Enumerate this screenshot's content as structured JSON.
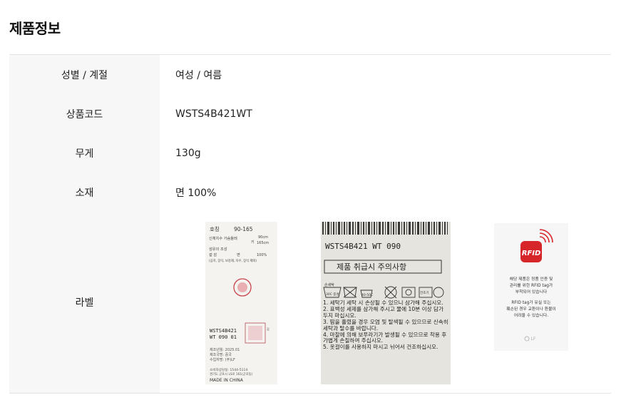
{
  "section": {
    "title": "제품정보"
  },
  "rows": [
    {
      "label": "성별 / 계절",
      "value": "여성 / 여름"
    },
    {
      "label": "상품코드",
      "value": "WSTS4B421WT"
    },
    {
      "label": "무게",
      "value": "130g"
    },
    {
      "label": "소재",
      "value": "면 100%"
    },
    {
      "label": "라벨"
    }
  ],
  "label_images": {
    "size_tag": {
      "lines": [
        "호칭",
        "90-165",
        "신체치수 가슴둘레",
        "90cm",
        "키",
        "165cm",
        "섬유의 조성",
        "겉 감",
        "면",
        "100%",
        "(심지, 장식, 보강재, 자수, 장식 제외)"
      ],
      "code": "WSTS4B421",
      "code2": "WT 090 01",
      "info": [
        "제조년월: 2025.01",
        "제조국명: 중국",
        "수입자명: (주)LF",
        "소비자상담실: 1544-5114",
        "경기도 군포시 LS로 161(군포동)",
        "MADE IN CHINA"
      ]
    },
    "care_tag": {
      "code": "WSTS4B421 WT 090",
      "heading": "제품 취급시 주의사항",
      "icons": [
        "손세탁",
        "30C 중성",
        "40-50C",
        "건조기"
      ],
      "steps": [
        "1. 세탁기 세탁 시 손상될 수 있으니 삼가해 주십시오.",
        "2. 표백성 세제를 삼가해 주시고 물에 10분 이상 담가 두지 마십시오.",
        "3. 땀을 흘렸을 경우 오염 및 탈색될 수 있으므로 신속히 세탁과 탈수를 바랍니다.",
        "4. 마찰에 의해 보푸라기가 발생될 수 있으므로 착용 후 가볍게 손질하여 주십시오.",
        "5. 옷걸이를 사용하지 마시고 뉘어서 건조하십시오."
      ]
    },
    "rfid_tag": {
      "logo": "RFID",
      "text1": [
        "해당 제품은 정품 인증 및",
        "관리를 위한 RFID tag가",
        "부착되어 있습니다"
      ],
      "text2": [
        "RFID tag가 유실 또는",
        "훼손된 경우 교환이나 환불이",
        "어려울 수 있습니다."
      ],
      "brand": "LF"
    }
  },
  "colors": {
    "rfid_red": "#d7262a",
    "header_bg": "#f7f7f7",
    "border": "#e3e3e3"
  }
}
